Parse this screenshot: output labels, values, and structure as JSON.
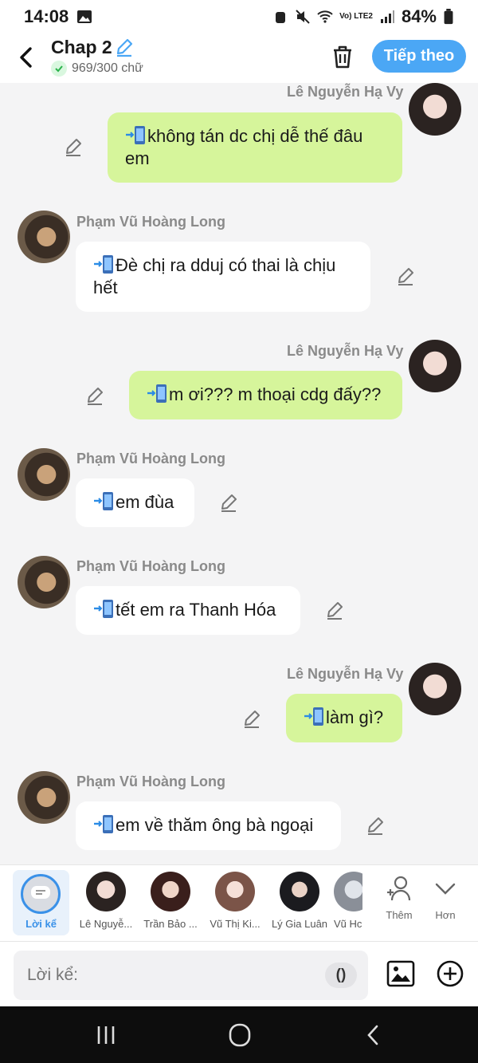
{
  "status": {
    "time": "14:08",
    "network": "Vo) LTE2",
    "battery": "84%"
  },
  "header": {
    "title": "Chap 2",
    "word_count": "969/300 chữ",
    "next_label": "Tiếp theo"
  },
  "messages": [
    {
      "side": "me",
      "sender": "Lê Nguyễn Hạ Vy",
      "lines": [
        "không tán dc chị dễ thế đâu",
        "em"
      ]
    },
    {
      "side": "them",
      "sender": "Phạm Vũ Hoàng Long",
      "lines": [
        "Đè chị ra dduj có thai là chịu",
        "hết"
      ]
    },
    {
      "side": "me",
      "sender": "Lê Nguyễn Hạ Vy",
      "lines": [
        "m ơi??? m thoại cdg đấy??"
      ]
    },
    {
      "side": "them",
      "sender": "Phạm Vũ Hoàng Long",
      "lines": [
        "em đùa"
      ]
    },
    {
      "side": "them",
      "sender": "Phạm Vũ Hoàng Long",
      "lines": [
        "tết em ra Thanh Hóa"
      ]
    },
    {
      "side": "me",
      "sender": "Lê Nguyễn Hạ Vy",
      "lines": [
        "làm gì?"
      ]
    },
    {
      "side": "them",
      "sender": "Phạm Vũ Hoàng Long",
      "lines": [
        "em về thăm ông bà ngoại"
      ]
    }
  ],
  "characters": {
    "narrator_label": "Lời kể",
    "items": [
      "Lê Nguyễ...",
      "Trần Bảo ...",
      "Vũ Thị Ki...",
      "Lý Gia Luân",
      "Vũ Hc"
    ],
    "add_label": "Thêm",
    "more_label": "Hơn"
  },
  "composer": {
    "placeholder": "Lời kể:",
    "paren_label": "()"
  },
  "colors": {
    "accent": "#4ba7f5",
    "my_bubble": "#d6f59b",
    "their_bubble": "#ffffff",
    "background": "#f4f4f5"
  },
  "icons": [
    "back-arrow-icon",
    "pencil-icon",
    "check-icon",
    "trash-icon",
    "phone-icon",
    "image-icon",
    "plus-circle-icon",
    "add-person-icon",
    "chevron-down-icon"
  ]
}
